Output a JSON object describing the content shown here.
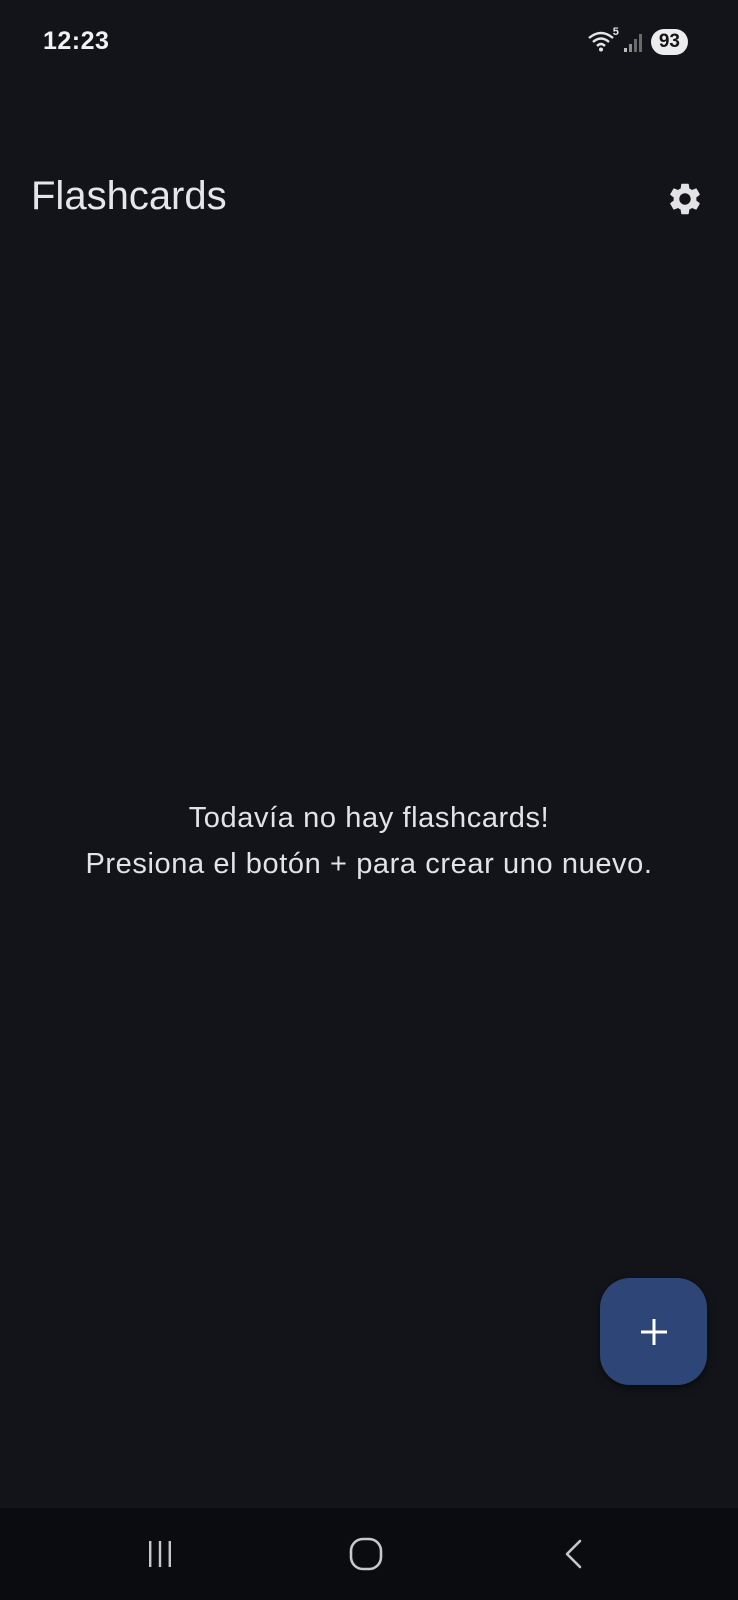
{
  "status_bar": {
    "time": "12:23",
    "wifi_badge": "5",
    "battery": "93"
  },
  "app_bar": {
    "title": "Flashcards",
    "settings_icon": "gear-icon"
  },
  "empty_state": {
    "line1": "Todavía no hay flashcards!",
    "line2": "Presiona el botón + para crear uno nuevo."
  },
  "fab": {
    "icon": "plus-icon",
    "color": "#2e4577"
  },
  "nav_bar": {
    "recents_icon": "recents-icon",
    "home_icon": "home-icon",
    "back_icon": "back-icon"
  },
  "colors": {
    "background": "#131419",
    "nav_background": "#0b0c0f",
    "text": "#e3e3e6"
  }
}
